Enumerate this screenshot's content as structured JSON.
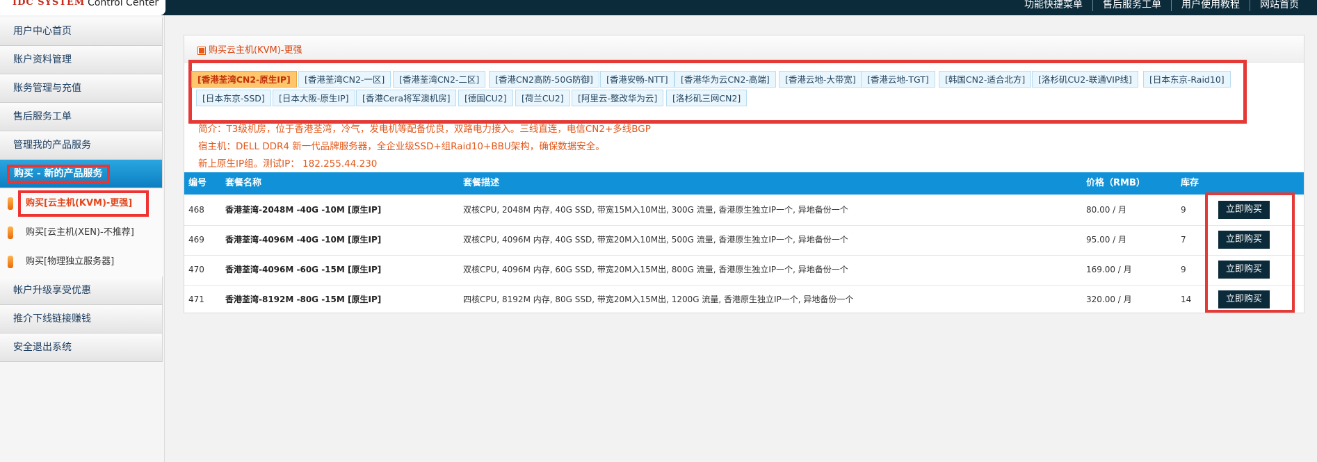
{
  "header": {
    "logo": "IDC SYSTEM",
    "subtitle": "Control Center",
    "links": [
      "功能快捷菜单",
      "售后服务工单",
      "用户使用教程",
      "网站首页"
    ]
  },
  "sidebar": {
    "items": [
      "用户中心首页",
      "账户资料管理",
      "账务管理与充值",
      "售后服务工单",
      "管理我的产品服务",
      "购买 - 新的产品服务"
    ],
    "active_label": "购买 - 新的产品服务",
    "sub_items": [
      "购买[云主机(KVM)-更强]",
      "购买[云主机(XEN)-不推荐]",
      "购买[物理独立服务器]"
    ],
    "bottom_items": [
      "帐户升级享受优惠",
      "推介下线链接赚钱",
      "安全退出系统"
    ]
  },
  "panel": {
    "title": "购买云主机(KVM)-更强",
    "tabs_row1": [
      "[香港荃湾CN2-原生IP]",
      "[香港荃湾CN2-一区]",
      "[香港荃湾CN2-二区]",
      "[香港CN2高防-50G防御]",
      "[香港安畅-NTT]",
      "[香港华为云CN2-高端]",
      "[香港云地-大带宽]",
      "[香港云地-TGT]",
      "[韩国CN2-适合北方]",
      "[洛杉矶CU2-联通VIP线]",
      "[日本东京-Raid10]"
    ],
    "tabs_row2": [
      "[日本东京-SSD]",
      "[日本大阪-原生IP]",
      "[香港Cera将军澳机房]",
      "[德国CU2]",
      "[荷兰CU2]",
      "[阿里云-整改华为云]",
      "[洛杉矶三网CN2]"
    ],
    "intro": [
      "简介：T3级机房，位于香港荃湾，冷气，发电机等配备优良，双路电力接入。三线直连，电信CN2+多线BGP",
      "宿主机：DELL DDR4 新一代品牌服务器，全企业级SSD+组Raid10+BBU架构，确保数据安全。",
      "新上原生IP组。测试IP： 182.255.44.230"
    ],
    "columns": [
      "编号",
      "套餐名称",
      "套餐描述",
      "价格（RMB）",
      "库存"
    ],
    "rows": [
      {
        "id": "468",
        "name": "香港荃湾-2048M -40G -10M [原生IP]",
        "desc": "双核CPU, 2048M 内存, 40G SSD, 带宽15M入10M出, 300G 流量, 香港原生独立IP一个, 异地备份一个",
        "price": "80.00 / 月",
        "stock": "9",
        "btn": "立即购买"
      },
      {
        "id": "469",
        "name": "香港荃湾-4096M -40G -10M [原生IP]",
        "desc": "双核CPU, 4096M 内存, 40G SSD, 带宽20M入10M出, 500G 流量, 香港原生独立IP一个, 异地备份一个",
        "price": "95.00 / 月",
        "stock": "7",
        "btn": "立即购买"
      },
      {
        "id": "470",
        "name": "香港荃湾-4096M -60G -15M [原生IP]",
        "desc": "双核CPU, 4096M 内存, 60G SSD, 带宽20M入15M出, 800G 流量, 香港原生独立IP一个, 异地备份一个",
        "price": "169.00 / 月",
        "stock": "9",
        "btn": "立即购买"
      },
      {
        "id": "471",
        "name": "香港荃湾-8192M -80G -15M [原生IP]",
        "desc": "四核CPU, 8192M 内存, 80G SSD, 带宽20M入15M出, 1200G 流量, 香港原生独立IP一个, 异地备份一个",
        "price": "320.00 / 月",
        "stock": "14",
        "btn": "立即购买"
      }
    ]
  }
}
